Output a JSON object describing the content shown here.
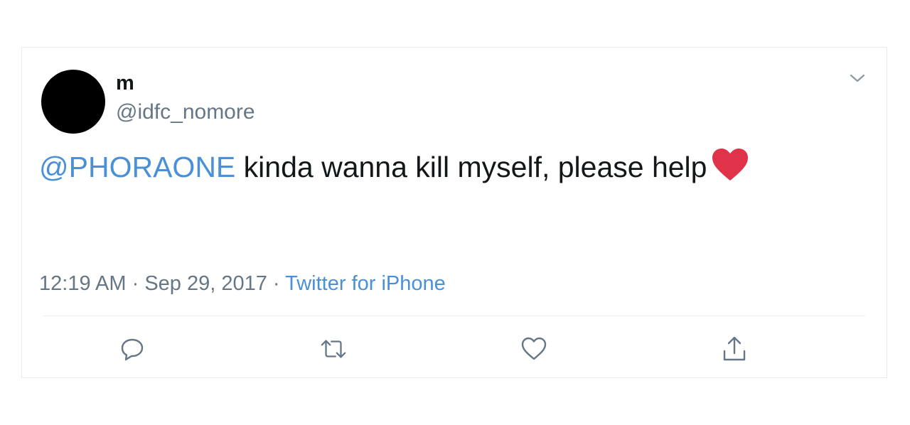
{
  "tweet": {
    "display_name": "m",
    "handle": "@idfc_nomore",
    "mention": "@PHORAONE",
    "text": " kinda wanna kill myself, please help",
    "emoji": "red-heart",
    "time": "12:19 AM",
    "separator1": " · ",
    "date": "Sep 29, 2017",
    "separator2": " · ",
    "source": "Twitter for iPhone"
  },
  "icons": {
    "caret": "chevron-down-icon",
    "reply": "reply-icon",
    "retweet": "retweet-icon",
    "like": "heart-icon",
    "share": "share-icon"
  },
  "colors": {
    "link": "#4a90d9",
    "muted": "#657786",
    "text": "#14171a",
    "heart": "#e0334a",
    "border": "#e6ecf0"
  }
}
